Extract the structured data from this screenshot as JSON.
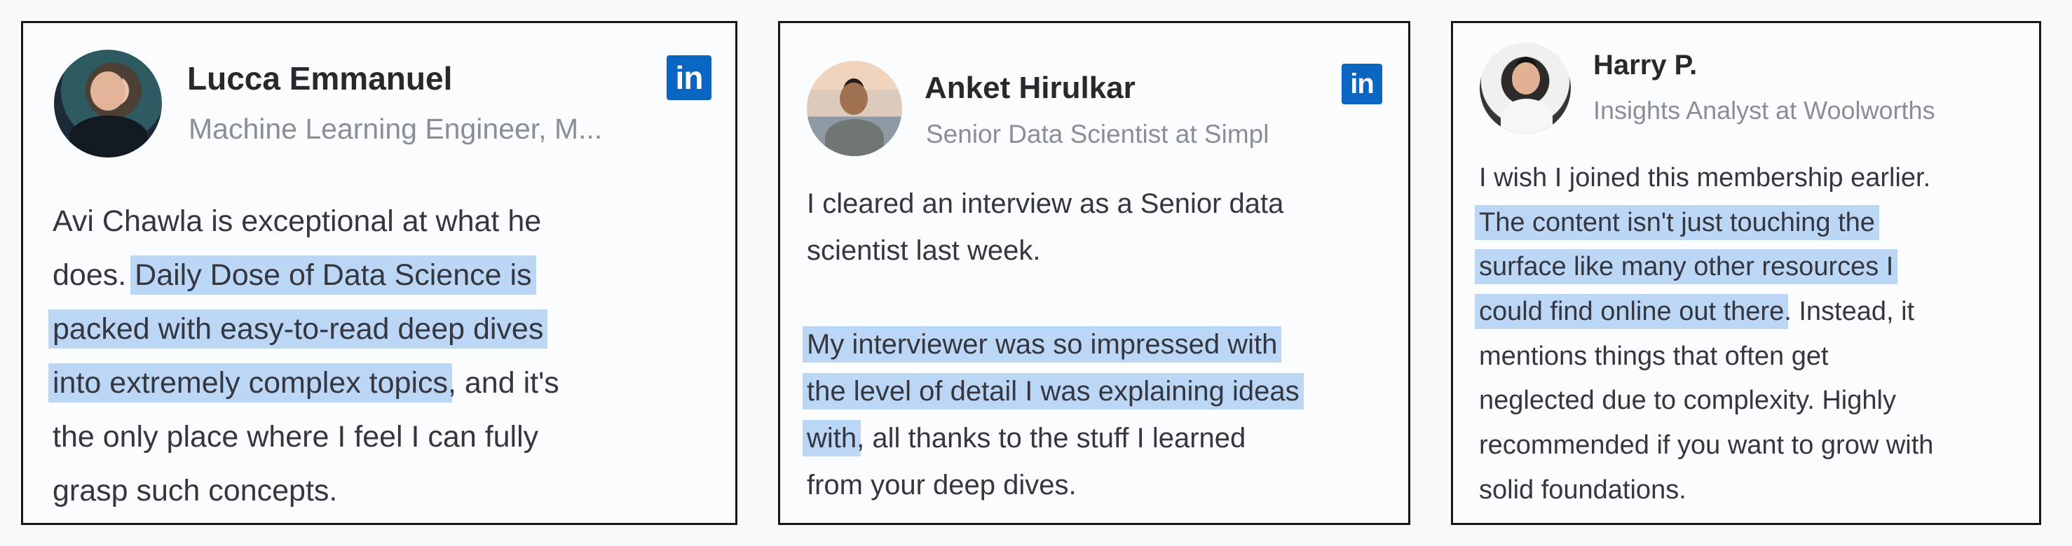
{
  "cards": [
    {
      "name": "Lucca Emmanuel",
      "subtitle": "Machine Learning Engineer, M...",
      "icon": "linkedin-icon",
      "brand_color": "#0a66c2",
      "highlight_color": "#bcd7f6",
      "lines": [
        {
          "before": "Avi Chawla is exceptional at what he",
          "highlighted": "",
          "after": ""
        },
        {
          "before": "does. ",
          "highlighted": "Daily Dose of Data Science is",
          "after": ""
        },
        {
          "before": "",
          "highlighted": "packed with easy-to-read deep dives",
          "after": ""
        },
        {
          "before": "",
          "highlighted": "into extremely complex topics",
          "after": ", and it's"
        },
        {
          "before": "the only place where I feel I can fully",
          "highlighted": "",
          "after": ""
        },
        {
          "before": "grasp such concepts.",
          "highlighted": "",
          "after": ""
        }
      ]
    },
    {
      "name": "Anket Hirulkar",
      "subtitle": "Senior Data Scientist at Simpl",
      "icon": "linkedin-icon",
      "brand_color": "#0a66c2",
      "highlight_color": "#bcd7f6",
      "lines": [
        {
          "before": "I cleared an interview as a Senior data",
          "highlighted": "",
          "after": ""
        },
        {
          "before": "scientist last week.",
          "highlighted": "",
          "after": ""
        },
        {
          "before": "",
          "highlighted": "",
          "after": ""
        },
        {
          "before": "",
          "highlighted": "My interviewer was so impressed with",
          "after": ""
        },
        {
          "before": "",
          "highlighted": "the level of detail I was explaining ideas",
          "after": ""
        },
        {
          "before": "",
          "highlighted": "with",
          "after": ", all thanks to the stuff I learned"
        },
        {
          "before": "from your deep dives.",
          "highlighted": "",
          "after": ""
        }
      ]
    },
    {
      "name": "Harry P.",
      "subtitle": "Insights Analyst at Woolworths",
      "icon": "",
      "brand_color": "#0a66c2",
      "highlight_color": "#bcd7f6",
      "lines": [
        {
          "before": "I wish I joined this membership earlier.",
          "highlighted": "",
          "after": ""
        },
        {
          "before": "",
          "highlighted": "The content isn't just touching the",
          "after": ""
        },
        {
          "before": "",
          "highlighted": "surface like many other resources I",
          "after": ""
        },
        {
          "before": "",
          "highlighted": "could find online out there",
          "after": ". Instead, it"
        },
        {
          "before": "mentions things that often get",
          "highlighted": "",
          "after": ""
        },
        {
          "before": "neglected due to complexity. Highly",
          "highlighted": "",
          "after": ""
        },
        {
          "before": "recommended if you want to grow with",
          "highlighted": "",
          "after": ""
        },
        {
          "before": "solid foundations.",
          "highlighted": "",
          "after": ""
        }
      ]
    }
  ],
  "linkedin_label": "in"
}
